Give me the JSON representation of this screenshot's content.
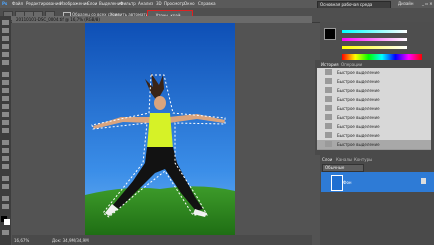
{
  "menu": {
    "logo": "Ps",
    "items": [
      "Файл",
      "Редактирование",
      "Изображение",
      "Слои",
      "Выделение",
      "Фильтр",
      "Анализ",
      "3D",
      "Просмотр",
      "Окно",
      "Справка"
    ],
    "workspace": "Основная рабочая среда",
    "design": "Дизайн"
  },
  "options": {
    "feather_label": "Образец со всех слоев",
    "auto_label": "Усилить автоматически",
    "refine_edge": "Уточн. край..."
  },
  "document": {
    "tab_title": "20110101-DSC_0004.tif @ 16,7% (RGB/8)",
    "zoom": "16,67%",
    "doc_info": "Док: 34,9М/34,9М"
  },
  "history": {
    "tabs": [
      "История",
      "Операции"
    ],
    "rows": [
      "Быстрое выделение",
      "Быстрое выделение",
      "Быстрое выделение",
      "Быстрое выделение",
      "Быстрое выделение",
      "Быстрое выделение",
      "Быстрое выделение",
      "Быстрое выделение",
      "Быстрое выделение",
      "Быстрое выделение",
      "Быстрое выделение"
    ]
  },
  "layers": {
    "tabs": [
      "Слои",
      "Каналы",
      "Контуры"
    ],
    "blend_mode": "Обычные",
    "layer_name": "Фон"
  },
  "colors": {
    "selection": "#d22222",
    "layer_selected": "#2e7bd6",
    "sky": "#1f6fd1",
    "grass": "#2f8a1f"
  }
}
